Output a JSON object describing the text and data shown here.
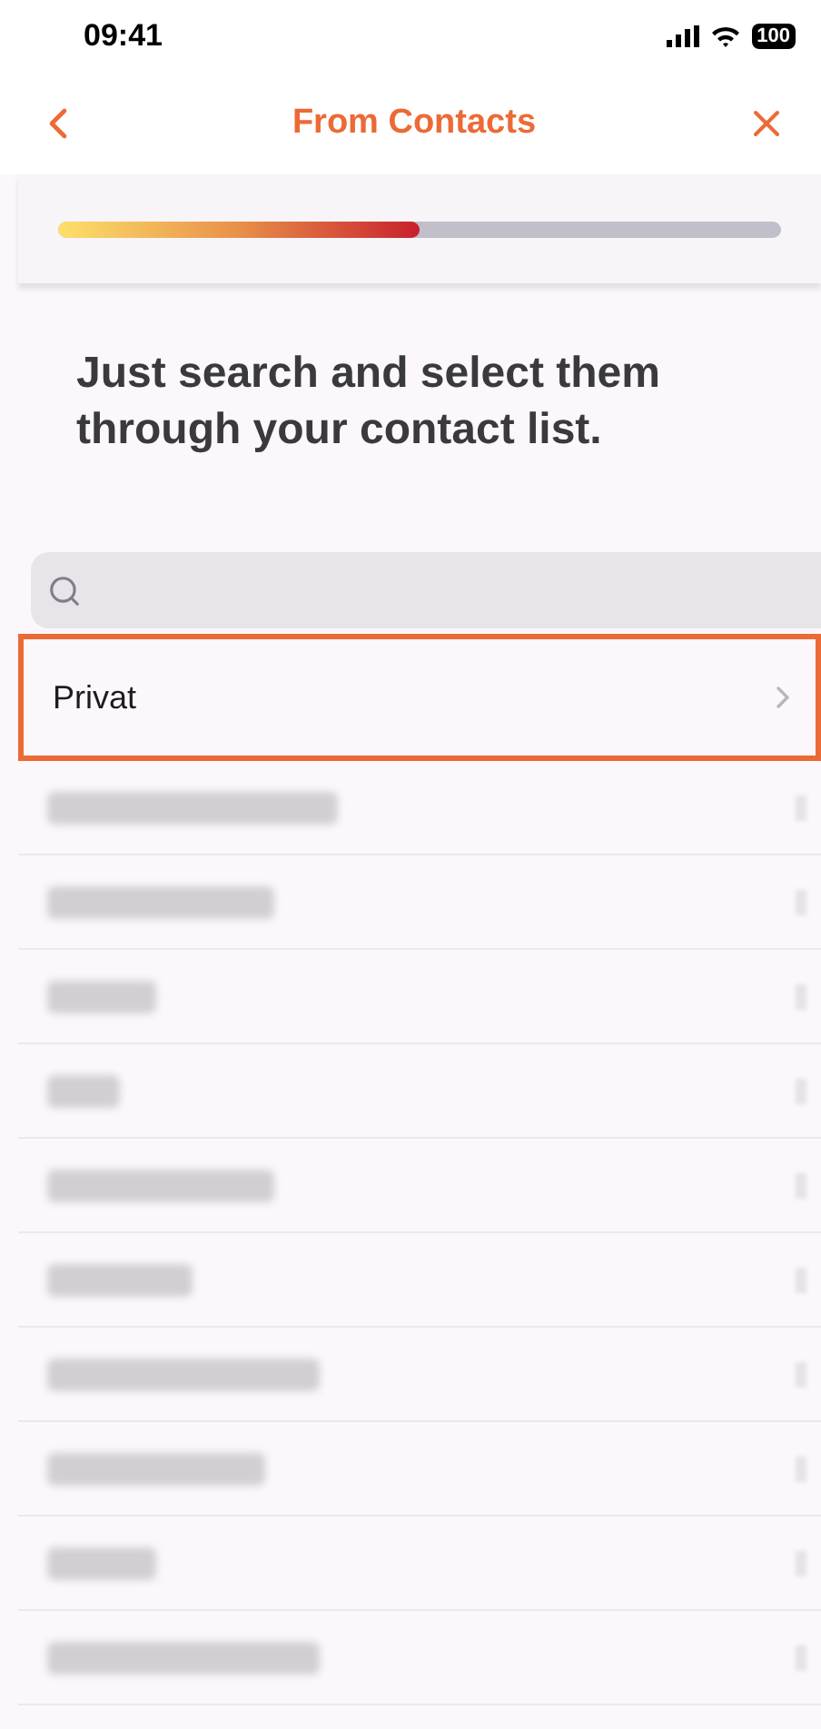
{
  "status_bar": {
    "time": "09:41",
    "battery": "100"
  },
  "nav": {
    "title": "From Contacts"
  },
  "progress": {
    "level": 0.5
  },
  "heading": "Just search and select them through your contact list.",
  "rows": [
    {
      "kind": "group",
      "label": "Privat",
      "selected": true
    },
    {
      "kind": "redacted",
      "selected": false
    },
    {
      "kind": "redacted",
      "selected": false
    },
    {
      "kind": "redacted",
      "selected": false
    },
    {
      "kind": "redacted",
      "selected": false
    },
    {
      "kind": "redacted",
      "selected": false
    },
    {
      "kind": "redacted",
      "selected": false
    },
    {
      "kind": "redacted",
      "selected": false
    },
    {
      "kind": "redacted",
      "selected": false
    },
    {
      "kind": "redacted",
      "selected": false
    },
    {
      "kind": "redacted",
      "selected": false
    }
  ]
}
